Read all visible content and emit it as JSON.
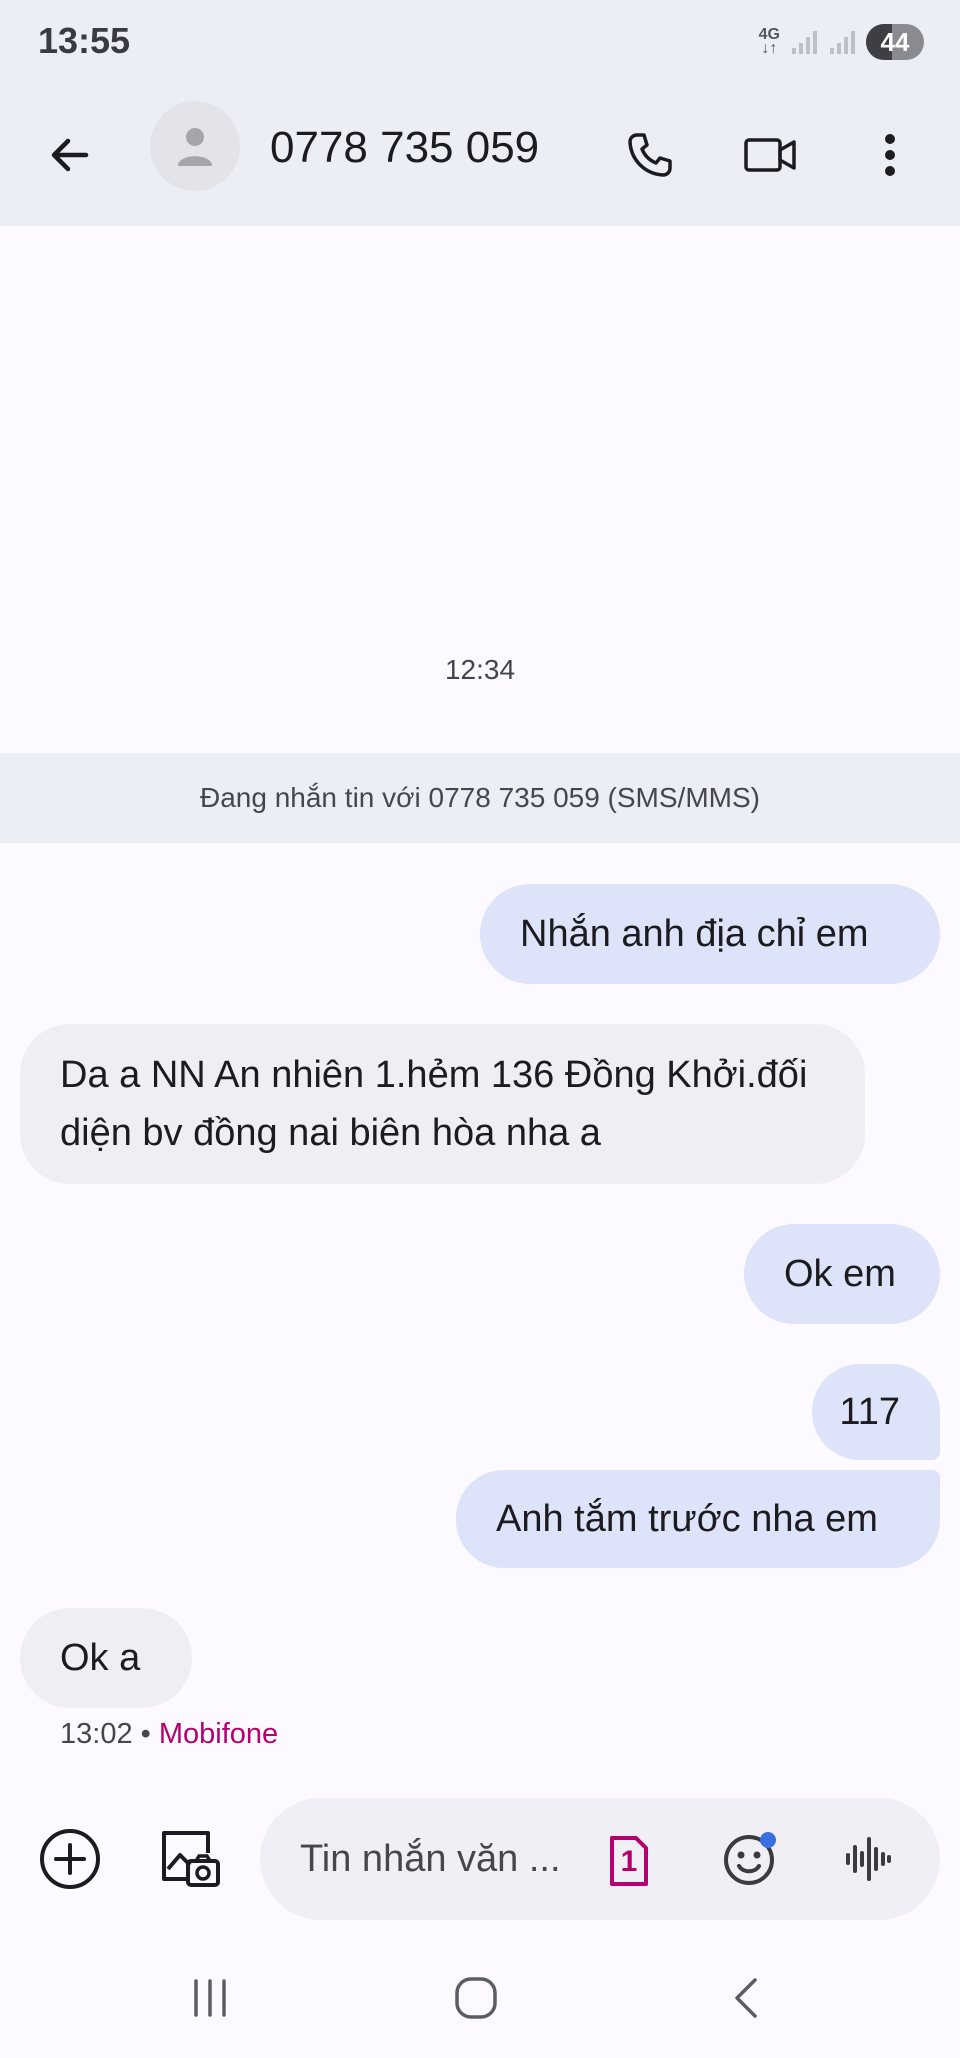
{
  "status_bar": {
    "time": "13:55",
    "network": "4G",
    "battery": "44"
  },
  "header": {
    "contact": "0778 735 059",
    "icons": [
      "back-arrow-icon",
      "avatar-icon",
      "phone-icon",
      "video-icon",
      "more-vert-icon"
    ]
  },
  "conversation": {
    "timestamp": "12:34",
    "info": "Đang nhắn tin với 0778 735 059 (SMS/MMS)",
    "messages": [
      {
        "direction": "outgoing",
        "text": "Nhắn anh địa chỉ em"
      },
      {
        "direction": "incoming",
        "lines": [
          "Da a NN An nhiên 1.hẻm 136 Đồng Khởi.đối",
          "diện bv đồng nai biên hòa nha a"
        ]
      },
      {
        "direction": "outgoing",
        "text": "Ok em"
      },
      {
        "direction": "outgoing",
        "text": "117"
      },
      {
        "direction": "outgoing",
        "text": "Anh tắm trước nha em"
      },
      {
        "direction": "incoming",
        "text": "Ok a"
      }
    ],
    "last_meta": {
      "time": "13:02",
      "separator": "•",
      "carrier": "Mobifone"
    }
  },
  "composer": {
    "placeholder": "Tin nhắn văn ...",
    "sim_number": "1",
    "icons": [
      "add-circle-icon",
      "gallery-icon",
      "sim-icon",
      "emoji-icon",
      "voice-icon"
    ]
  },
  "colors": {
    "outgoing_bubble": "#dde3f9",
    "incoming_bubble": "#efeff3",
    "carrier_accent": "#b5006f",
    "header_bg": "#eceef6"
  }
}
